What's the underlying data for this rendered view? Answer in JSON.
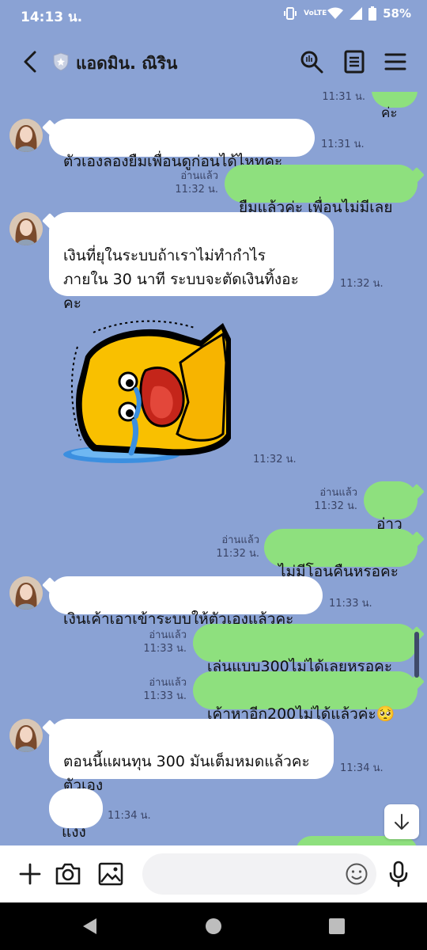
{
  "status_bar": {
    "time": "14:13 น.",
    "battery": "58%",
    "network": "VoLTE"
  },
  "header": {
    "title": "แอดมิน. ณิริน"
  },
  "messages": [
    {
      "side": "out",
      "text": "ค่ะ",
      "time": "11:31 น.",
      "read": ""
    },
    {
      "side": "in",
      "text": "ตัวเองลองยืมเพื่อนดูก่อนได้ไหทคะ",
      "time": "11:31 น."
    },
    {
      "side": "out",
      "text": "ยืมแล้วค่ะ เพื่อนไม่มีเลย",
      "time": "11:32 น.",
      "read": "อ่านแล้ว"
    },
    {
      "side": "in",
      "text": "เงินที่ยุในระบบถ้าเราไม่ทำกำไร\nภายใน 30 นาที ระบบจะตัดเงินทิ้งอะ\nคะ",
      "time": "11:32 น."
    },
    {
      "side": "in",
      "type": "sticker",
      "time": "11:32 น."
    },
    {
      "side": "out",
      "text": "อ่าว",
      "time": "11:32 น.",
      "read": "อ่านแล้ว"
    },
    {
      "side": "out",
      "text": "ไม่มีโอนคืนหรอคะ",
      "time": "11:32 น.",
      "read": "อ่านแล้ว"
    },
    {
      "side": "in",
      "text": "เงินเค้าเอาเข้าระบบให้ตัวเองแล้วคะ",
      "time": "11:33 น."
    },
    {
      "side": "out",
      "text": "เล่นแบบ300ไม่ได้เลยหรอคะ",
      "time": "11:33 น.",
      "read": "อ่านแล้ว"
    },
    {
      "side": "out",
      "text": "เค้าหาอีก200ไม่ได้แล้วค่ะ🥺",
      "time": "11:33 น.",
      "read": "อ่านแล้ว"
    },
    {
      "side": "in",
      "text": "ตอนนี้แผนทุน 300 มันเต็มหมดแล้วคะ\nตัวเอง",
      "time": "11:34 น."
    },
    {
      "side": "in",
      "text": "แงง",
      "time": "11:34 น."
    }
  ],
  "colors": {
    "background": "#8aa2d4",
    "bubble_out": "#8ee07e",
    "bubble_in": "#ffffff"
  },
  "icons": [
    "back-arrow-icon",
    "shield-icon",
    "search-icon",
    "notes-icon",
    "menu-icon",
    "plus-icon",
    "camera-icon",
    "image-icon",
    "emoji-icon",
    "microphone-icon",
    "scroll-down-icon"
  ]
}
